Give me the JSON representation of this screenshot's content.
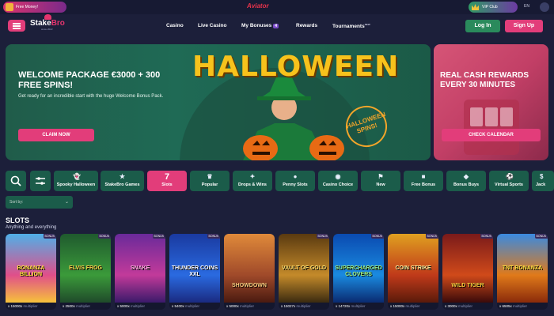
{
  "top_strip": {
    "free_money_label": "Free Money!",
    "brand_center": "Aviator",
    "vip_label": "VIP Club",
    "language": "EN",
    "colors": {
      "pink": "#e23d7a",
      "green": "#2a8a5c"
    }
  },
  "nav": {
    "logo_text_a": "Stake",
    "logo_text_b": "Bro",
    "logo_tagline": "since 2022",
    "links": {
      "casino": "Casino",
      "live_casino": "Live Casino",
      "my_bonuses": "My Bonuses",
      "my_bonuses_count": "4",
      "rewards": "Rewards",
      "tournaments": "Tournaments",
      "tournaments_tag": "NEW"
    },
    "login": "Log In",
    "signup": "Sign Up"
  },
  "hero": {
    "title": "WELCOME PACKAGE €3000 + 300 FREE SPINS!",
    "subtitle": "Get ready for an incredible start with the huge Welcome Bonus Pack.",
    "cta": "CLAIM NOW",
    "art_word": "HALLOWEEN",
    "seal_text": "HALLOWEEN SPINS!"
  },
  "promo": {
    "title": "REAL CASH REWARDS EVERY 30 MINUTES",
    "cta": "CHECK CALENDAR"
  },
  "categories": {
    "items": [
      {
        "label": "Spooky Halloween",
        "icon": "ghost-icon"
      },
      {
        "label": "StakeBro Games",
        "icon": "star-icon"
      },
      {
        "label": "Slots",
        "icon": "slot-7-icon",
        "active": true,
        "num": "7"
      },
      {
        "label": "Popular",
        "icon": "crown-icon"
      },
      {
        "label": "Drops & Wins",
        "icon": "drop-icon"
      },
      {
        "label": "Penny Slots",
        "icon": "coin-icon"
      },
      {
        "label": "Casino Choice",
        "icon": "chips-icon"
      },
      {
        "label": "New",
        "icon": "flag-icon"
      },
      {
        "label": "Free Bonus",
        "icon": "gift-icon"
      },
      {
        "label": "Bonus Buys",
        "icon": "cart-icon"
      },
      {
        "label": "Virtual Sports",
        "icon": "ball-icon"
      },
      {
        "label": "Jack",
        "icon": "jackpot-icon"
      }
    ]
  },
  "sort": {
    "label": "Sort by:"
  },
  "section": {
    "title": "SLOTS",
    "subtitle": "Anything and everything"
  },
  "games": {
    "multiplier_label": "multiplier",
    "items": [
      {
        "name": "BONANZA BILLION",
        "mult": "x 15000x",
        "bonus": "BONUS"
      },
      {
        "name": "ELVIS FROG",
        "mult": "x 2500x",
        "bonus": "BONUS"
      },
      {
        "name": "SNAKE",
        "mult": "x 5000x",
        "bonus": "BONUS"
      },
      {
        "name": "THUNDER COINS XXL",
        "mult": "x 5400x",
        "bonus": "BONUS"
      },
      {
        "name": "SHOWDOWN",
        "mult": "x 5000x",
        "bonus": ""
      },
      {
        "name": "VAULT OF GOLD",
        "mult": "x 15027x",
        "bonus": "BONUS"
      },
      {
        "name": "SUPERCHARGED CLOVERS",
        "mult": "x 14720x",
        "bonus": "BONUS"
      },
      {
        "name": "COIN STRIKE",
        "mult": "x 15000x",
        "bonus": "BONUS"
      },
      {
        "name": "WILD TIGER",
        "mult": "x 3000x",
        "bonus": "BONUS"
      },
      {
        "name": "TNT BONANZA",
        "mult": "x 6505x",
        "bonus": "BONUS"
      }
    ]
  }
}
